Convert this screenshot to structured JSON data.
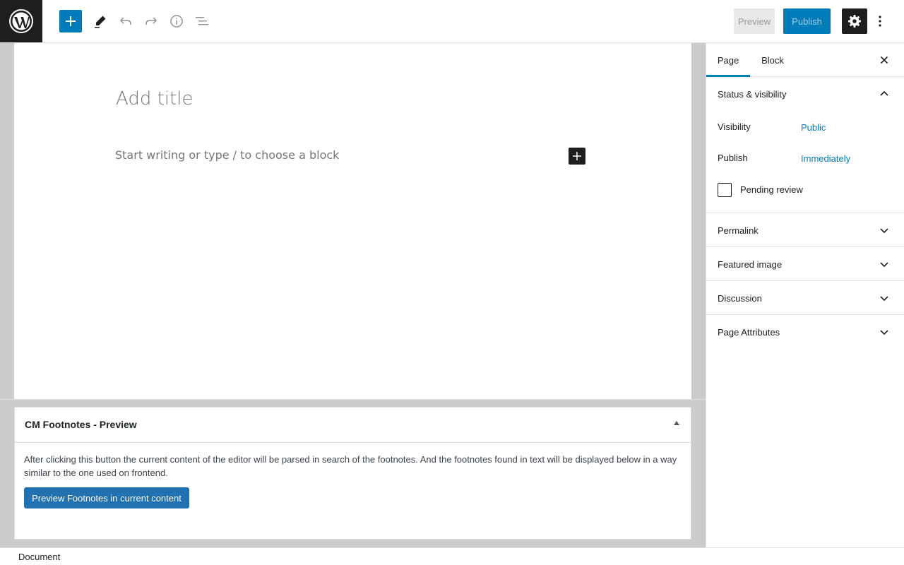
{
  "topbar": {
    "logo_icon": "wordpress-logo-icon",
    "inserter_icon": "plus-icon",
    "tools_icon": "pencil-icon",
    "undo_icon": "undo-icon",
    "redo_icon": "redo-icon",
    "details_icon": "info-icon",
    "outline_icon": "list-view-icon",
    "preview_label": "Preview",
    "publish_label": "Publish",
    "settings_icon": "gear-icon",
    "more_icon": "more-vertical-icon"
  },
  "editor": {
    "title_placeholder": "Add title",
    "block_placeholder": "Start writing or type / to choose a block"
  },
  "metabox": {
    "title": "CM Footnotes - Preview",
    "description": "After clicking this button the current content of the editor will be parsed in search of the footnotes. And the footnotes found in text will be displayed below in a way similar to the one used on frontend.",
    "button_label": "Preview Footnotes in current content"
  },
  "sidebar": {
    "tabs": [
      {
        "label": "Page",
        "active": true
      },
      {
        "label": "Block",
        "active": false
      }
    ],
    "status": {
      "title": "Status & visibility",
      "visibility_label": "Visibility",
      "visibility_value": "Public",
      "publish_label": "Publish",
      "publish_value": "Immediately",
      "pending_label": "Pending review"
    },
    "panels": [
      {
        "title": "Permalink"
      },
      {
        "title": "Featured image"
      },
      {
        "title": "Discussion"
      },
      {
        "title": "Page Attributes"
      }
    ]
  },
  "statusbar": {
    "breadcrumb": "Document"
  },
  "colors": {
    "accent": "#007cba",
    "dark": "#1e1e1e",
    "metabox_button": "#2271b1"
  }
}
